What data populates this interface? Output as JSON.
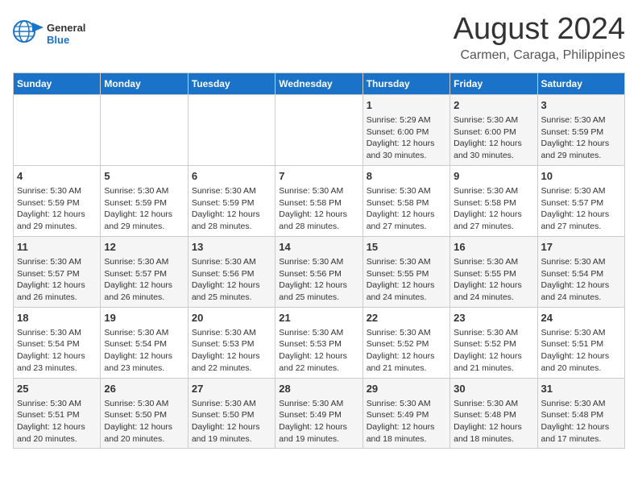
{
  "header": {
    "logo_line1": "General",
    "logo_line2": "Blue",
    "month": "August 2024",
    "location": "Carmen, Caraga, Philippines"
  },
  "weekdays": [
    "Sunday",
    "Monday",
    "Tuesday",
    "Wednesday",
    "Thursday",
    "Friday",
    "Saturday"
  ],
  "weeks": [
    [
      {
        "day": "",
        "info": ""
      },
      {
        "day": "",
        "info": ""
      },
      {
        "day": "",
        "info": ""
      },
      {
        "day": "",
        "info": ""
      },
      {
        "day": "1",
        "info": "Sunrise: 5:29 AM\nSunset: 6:00 PM\nDaylight: 12 hours and 30 minutes."
      },
      {
        "day": "2",
        "info": "Sunrise: 5:30 AM\nSunset: 6:00 PM\nDaylight: 12 hours and 30 minutes."
      },
      {
        "day": "3",
        "info": "Sunrise: 5:30 AM\nSunset: 5:59 PM\nDaylight: 12 hours and 29 minutes."
      }
    ],
    [
      {
        "day": "4",
        "info": "Sunrise: 5:30 AM\nSunset: 5:59 PM\nDaylight: 12 hours and 29 minutes."
      },
      {
        "day": "5",
        "info": "Sunrise: 5:30 AM\nSunset: 5:59 PM\nDaylight: 12 hours and 29 minutes."
      },
      {
        "day": "6",
        "info": "Sunrise: 5:30 AM\nSunset: 5:59 PM\nDaylight: 12 hours and 28 minutes."
      },
      {
        "day": "7",
        "info": "Sunrise: 5:30 AM\nSunset: 5:58 PM\nDaylight: 12 hours and 28 minutes."
      },
      {
        "day": "8",
        "info": "Sunrise: 5:30 AM\nSunset: 5:58 PM\nDaylight: 12 hours and 27 minutes."
      },
      {
        "day": "9",
        "info": "Sunrise: 5:30 AM\nSunset: 5:58 PM\nDaylight: 12 hours and 27 minutes."
      },
      {
        "day": "10",
        "info": "Sunrise: 5:30 AM\nSunset: 5:57 PM\nDaylight: 12 hours and 27 minutes."
      }
    ],
    [
      {
        "day": "11",
        "info": "Sunrise: 5:30 AM\nSunset: 5:57 PM\nDaylight: 12 hours and 26 minutes."
      },
      {
        "day": "12",
        "info": "Sunrise: 5:30 AM\nSunset: 5:57 PM\nDaylight: 12 hours and 26 minutes."
      },
      {
        "day": "13",
        "info": "Sunrise: 5:30 AM\nSunset: 5:56 PM\nDaylight: 12 hours and 25 minutes."
      },
      {
        "day": "14",
        "info": "Sunrise: 5:30 AM\nSunset: 5:56 PM\nDaylight: 12 hours and 25 minutes."
      },
      {
        "day": "15",
        "info": "Sunrise: 5:30 AM\nSunset: 5:55 PM\nDaylight: 12 hours and 24 minutes."
      },
      {
        "day": "16",
        "info": "Sunrise: 5:30 AM\nSunset: 5:55 PM\nDaylight: 12 hours and 24 minutes."
      },
      {
        "day": "17",
        "info": "Sunrise: 5:30 AM\nSunset: 5:54 PM\nDaylight: 12 hours and 24 minutes."
      }
    ],
    [
      {
        "day": "18",
        "info": "Sunrise: 5:30 AM\nSunset: 5:54 PM\nDaylight: 12 hours and 23 minutes."
      },
      {
        "day": "19",
        "info": "Sunrise: 5:30 AM\nSunset: 5:54 PM\nDaylight: 12 hours and 23 minutes."
      },
      {
        "day": "20",
        "info": "Sunrise: 5:30 AM\nSunset: 5:53 PM\nDaylight: 12 hours and 22 minutes."
      },
      {
        "day": "21",
        "info": "Sunrise: 5:30 AM\nSunset: 5:53 PM\nDaylight: 12 hours and 22 minutes."
      },
      {
        "day": "22",
        "info": "Sunrise: 5:30 AM\nSunset: 5:52 PM\nDaylight: 12 hours and 21 minutes."
      },
      {
        "day": "23",
        "info": "Sunrise: 5:30 AM\nSunset: 5:52 PM\nDaylight: 12 hours and 21 minutes."
      },
      {
        "day": "24",
        "info": "Sunrise: 5:30 AM\nSunset: 5:51 PM\nDaylight: 12 hours and 20 minutes."
      }
    ],
    [
      {
        "day": "25",
        "info": "Sunrise: 5:30 AM\nSunset: 5:51 PM\nDaylight: 12 hours and 20 minutes."
      },
      {
        "day": "26",
        "info": "Sunrise: 5:30 AM\nSunset: 5:50 PM\nDaylight: 12 hours and 20 minutes."
      },
      {
        "day": "27",
        "info": "Sunrise: 5:30 AM\nSunset: 5:50 PM\nDaylight: 12 hours and 19 minutes."
      },
      {
        "day": "28",
        "info": "Sunrise: 5:30 AM\nSunset: 5:49 PM\nDaylight: 12 hours and 19 minutes."
      },
      {
        "day": "29",
        "info": "Sunrise: 5:30 AM\nSunset: 5:49 PM\nDaylight: 12 hours and 18 minutes."
      },
      {
        "day": "30",
        "info": "Sunrise: 5:30 AM\nSunset: 5:48 PM\nDaylight: 12 hours and 18 minutes."
      },
      {
        "day": "31",
        "info": "Sunrise: 5:30 AM\nSunset: 5:48 PM\nDaylight: 12 hours and 17 minutes."
      }
    ]
  ]
}
